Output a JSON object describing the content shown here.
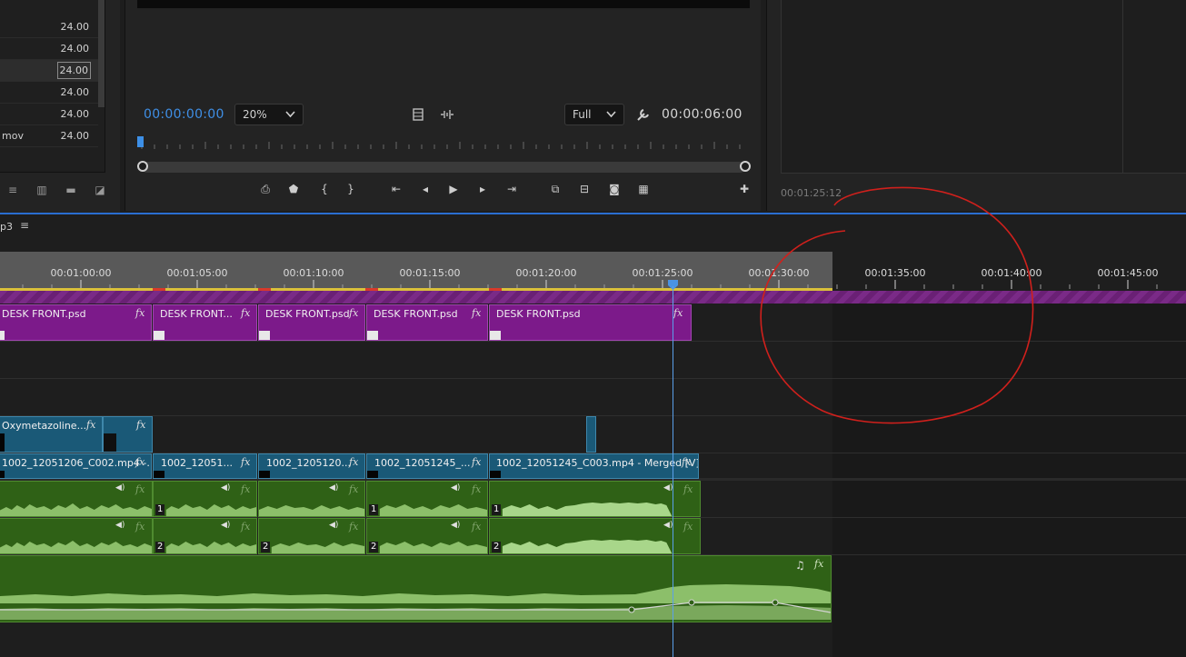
{
  "project": {
    "rows": [
      {
        "name": "",
        "fps": "24.00"
      },
      {
        "name": "",
        "fps": "24.00"
      },
      {
        "name": "",
        "fps": "24.00",
        "selected": true
      },
      {
        "name": "",
        "fps": "24.00"
      },
      {
        "name": "",
        "fps": "24.00"
      },
      {
        "name": "mov",
        "fps": "24.00"
      }
    ],
    "tools": [
      "list-view-icon",
      "icon-view-icon",
      "new-bin-icon",
      "new-item-icon"
    ]
  },
  "source": {
    "timecode_in": "00:00:00:00",
    "zoom": "20%",
    "resolution": "Full",
    "duration": "00:00:06:00",
    "accent": "#3f8fe6"
  },
  "program": {
    "timecode": "00:01:25:12"
  },
  "timeline": {
    "sequence_name": "p3",
    "ruler": [
      "00:01:00:00",
      "00:01:05:00",
      "00:01:10:00",
      "00:01:15:00",
      "00:01:20:00",
      "00:01:25:00",
      "00:01:30:00",
      "00:01:35:00",
      "00:01:40:00",
      "00:01:45:00"
    ],
    "v3_clips": [
      "DESK FRONT.psd",
      "DESK FRONT...",
      "DESK FRONT.psd",
      "DESK FRONT.psd",
      "DESK FRONT.psd"
    ],
    "v2_clips": [
      "Oxymetazoline..."
    ],
    "v1_clips": [
      "1002_12051206_C002.mp4 -...",
      "1002_12051...",
      "1002_1205120...",
      "1002_12051245_...",
      "1002_12051245_C003.mp4 - Merged [V]"
    ],
    "fx_label": "fx",
    "a1_channel": "1",
    "a2_channel": "2",
    "colors": {
      "graphic": "#7c1a8a",
      "video": "#1a5977",
      "audio": "#2f6116",
      "playhead": "#4a93e4",
      "annotation": "#d0201c"
    }
  }
}
